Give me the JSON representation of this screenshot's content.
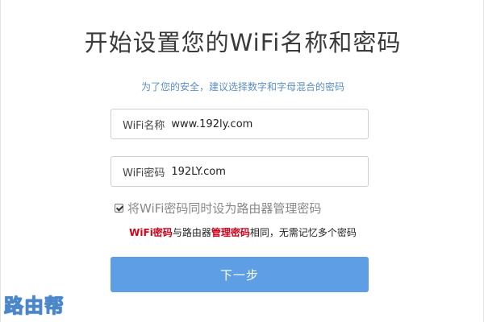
{
  "page": {
    "title": "开始设置您的WiFi名称和密码",
    "hint": "为了您的安全，建议选择数字和字母混合的密码"
  },
  "form": {
    "ssid": {
      "label": "WiFi名称",
      "value": "www.192ly.com"
    },
    "password": {
      "label": "WiFi密码",
      "value": "192LY.com"
    },
    "sync_checkbox": {
      "label": "将WiFi密码同时设为路由器管理密码",
      "checked": true
    },
    "note": {
      "part1": "WiFi密码",
      "part2": "与路由器",
      "part3": "管理密码",
      "part4": "相同，无需记忆多个密码"
    },
    "next_label": "下一步"
  },
  "watermark": {
    "text": "路由帮"
  },
  "colors": {
    "accent_button": "#5d9ee5",
    "hint_text": "#5b8fc2",
    "emphasis_red": "#d0021b",
    "title_text": "#3a3a3a"
  }
}
